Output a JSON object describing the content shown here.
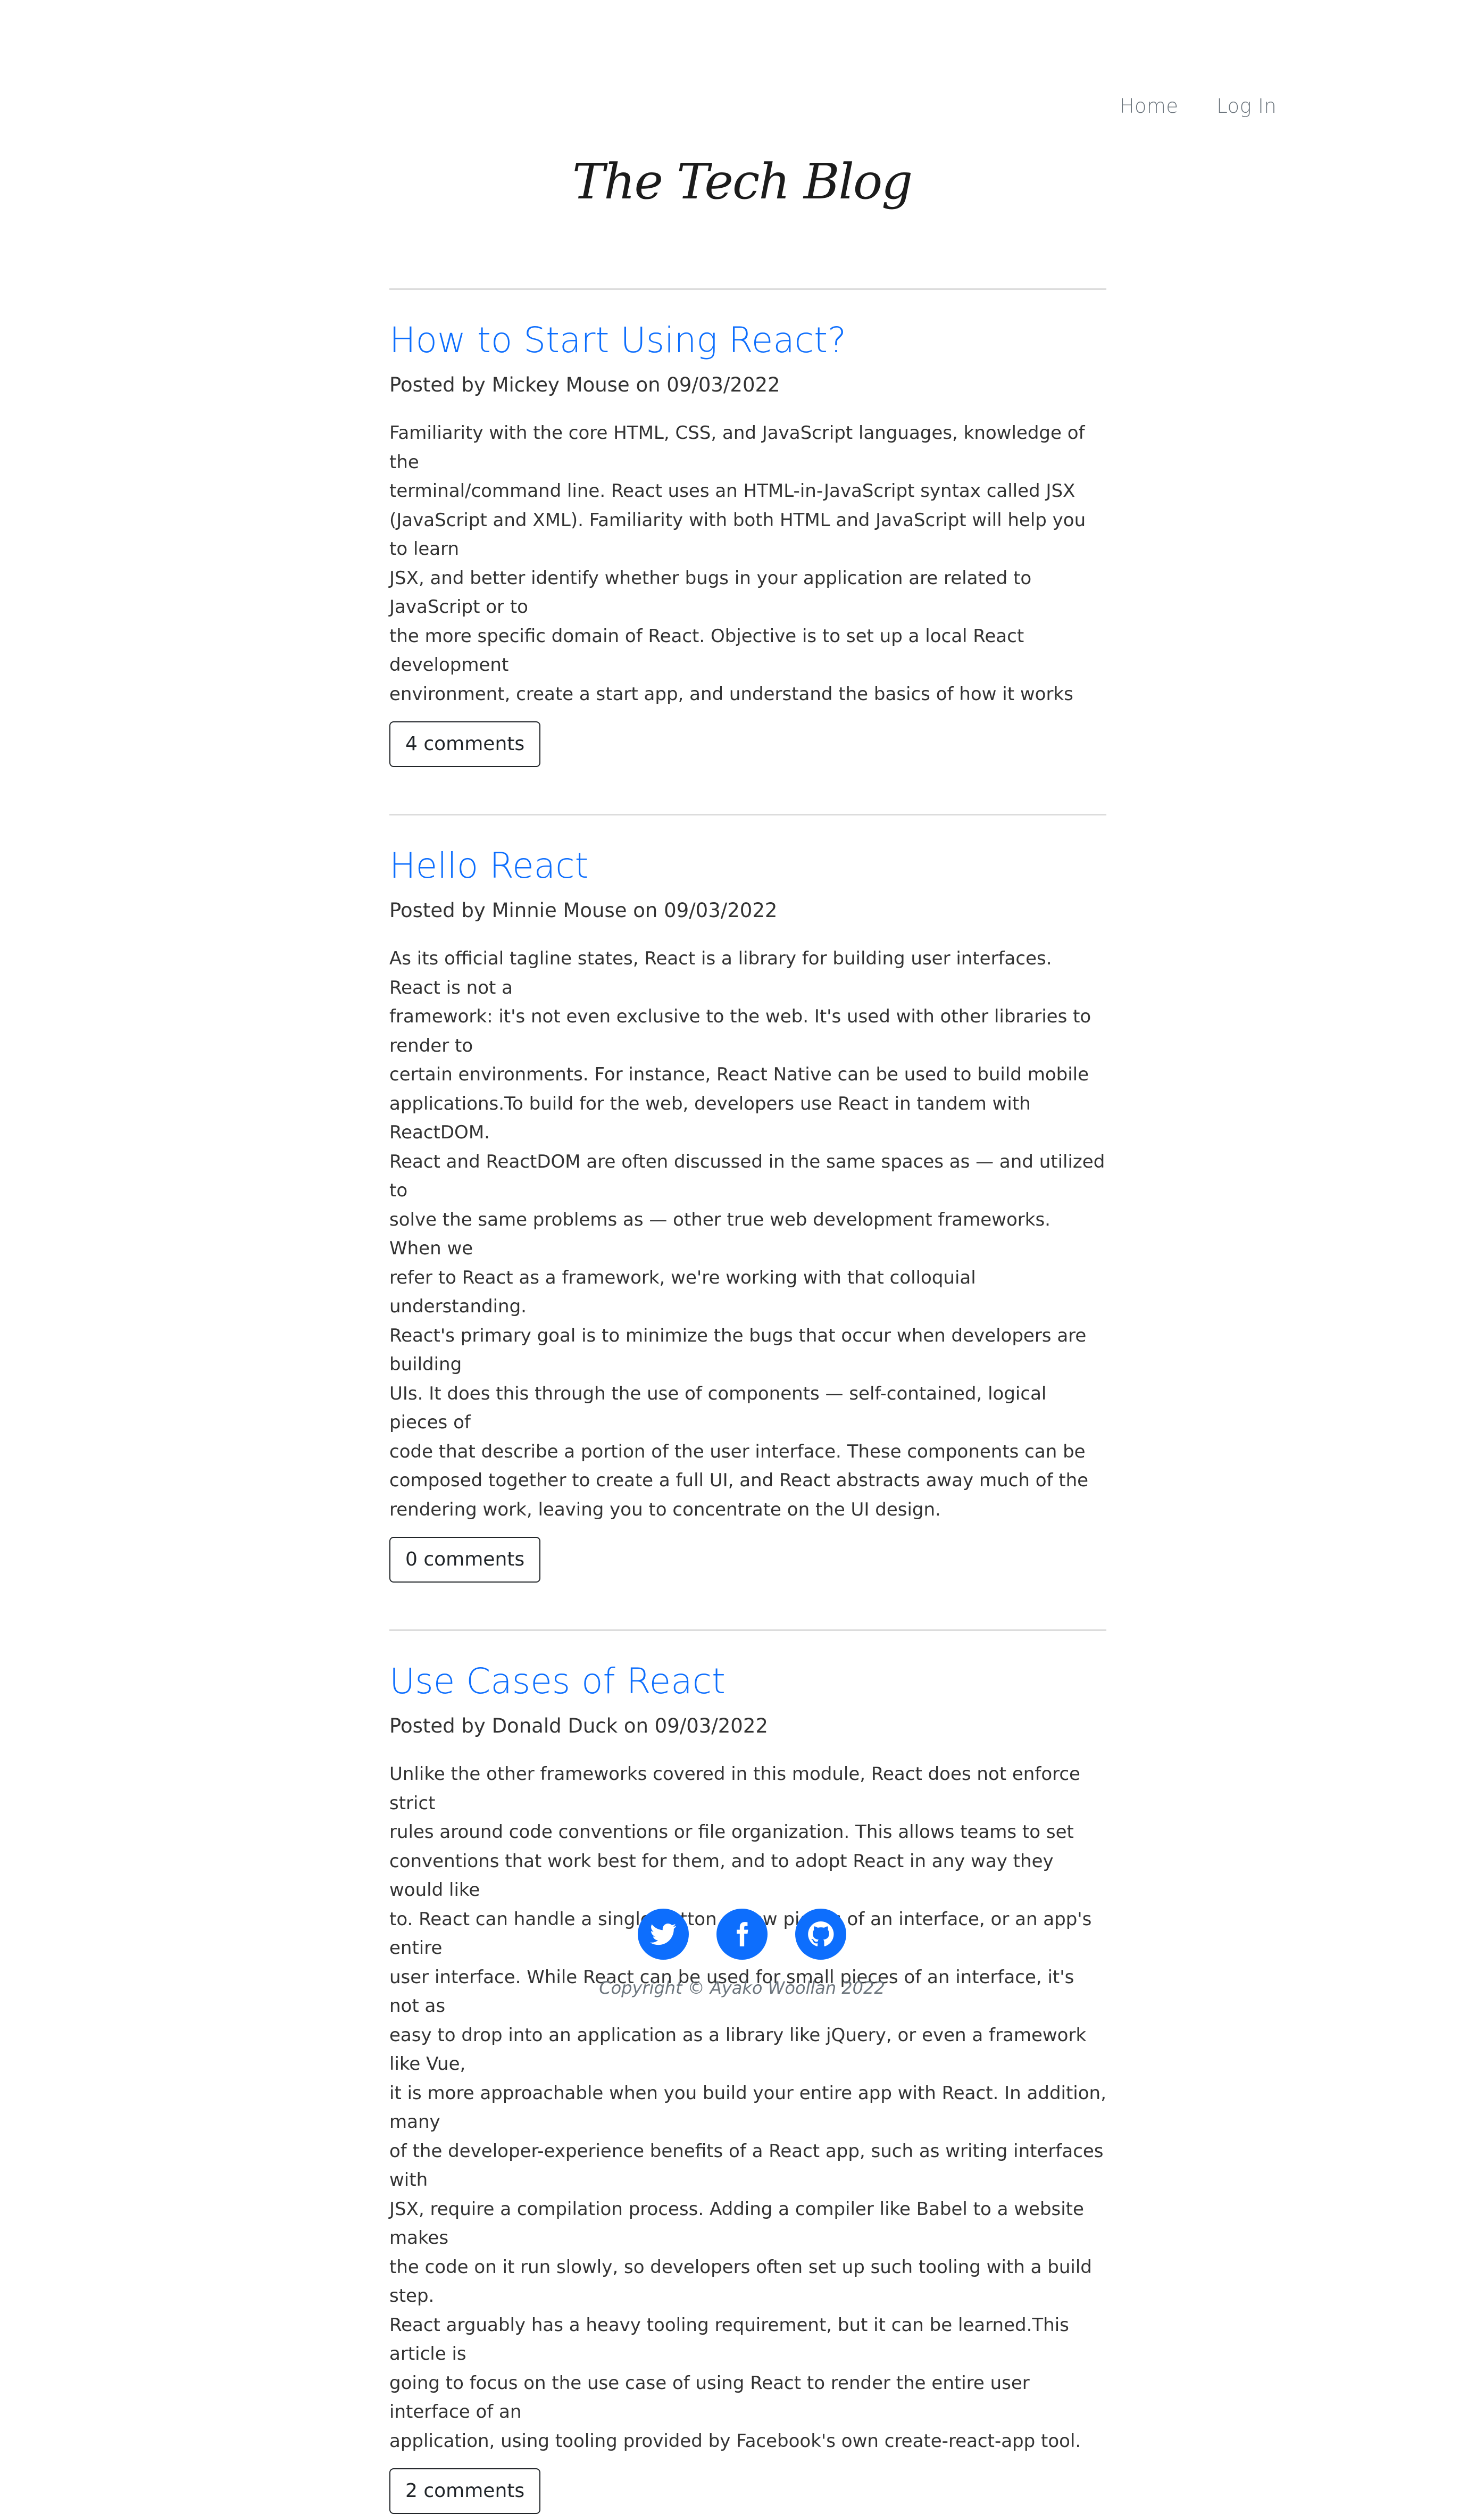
{
  "nav": {
    "items": [
      {
        "label": "Home"
      },
      {
        "label": "Log In"
      }
    ]
  },
  "header": {
    "logo_text": "The Tech Blog"
  },
  "posts": [
    {
      "title": "How to Start Using React?",
      "meta": "Posted by Mickey Mouse on 09/03/2022",
      "body": "Familiarity with the core HTML, CSS, and JavaScript languages, knowledge of the\nterminal/command line. React uses an HTML-in-JavaScript syntax called JSX\n(JavaScript and XML). Familiarity with both HTML and JavaScript will help you to learn\nJSX, and better identify whether bugs in your application are related to JavaScript or to\nthe more specific domain of React. Objective is to set up a local React development\nenvironment, create a start app, and understand the basics of how it works",
      "comments_label": "4 comments"
    },
    {
      "title": "Hello React",
      "meta": "Posted by Minnie Mouse on 09/03/2022",
      "body": "As its official tagline states, React is a library for building user interfaces. React is not a\nframework: it's not even exclusive to the web. It's used with other libraries to render to\ncertain environments. For instance, React Native can be used to build mobile\napplications.To build for the web, developers use React in tandem with ReactDOM.\nReact and ReactDOM are often discussed in the same spaces as — and utilized to\nsolve the same problems as — other true web development frameworks. When we\nrefer to React as a framework, we're working with that colloquial understanding.\nReact's primary goal is to minimize the bugs that occur when developers are building\nUIs. It does this through the use of components — self-contained, logical pieces of\ncode that describe a portion of the user interface. These components can be\ncomposed together to create a full UI, and React abstracts away much of the\nrendering work, leaving you to concentrate on the UI design.",
      "comments_label": "0 comments"
    },
    {
      "title": "Use Cases of React",
      "meta": "Posted by Donald Duck on 09/03/2022",
      "body": "Unlike the other frameworks covered in this module, React does not enforce strict\nrules around code conventions or file organization. This allows teams to set\nconventions that work best for them, and to adopt React in any way they would like\nto. React can handle a single button, a few pieces of an interface, or an app's entire\nuser interface. While React can be used for small pieces of an interface, it's not as\neasy to drop into an application as a library like jQuery, or even a framework like Vue,\nit is more approachable when you build your entire app with React. In addition, many\nof the developer-experience benefits of a React app, such as writing interfaces with\nJSX, require a compilation process. Adding a compiler like Babel to a website makes\nthe code on it run slowly, so developers often set up such tooling with a build step.\nReact arguably has a heavy tooling requirement, but it can be learned.This article is\ngoing to focus on the use case of using React to render the entire user interface of an\napplication, using tooling provided by Facebook's own create-react-app tool.",
      "comments_label": "2 comments"
    }
  ],
  "footer": {
    "socials": [
      {
        "icon": "twitter-icon"
      },
      {
        "icon": "facebook-icon"
      },
      {
        "icon": "github-icon"
      }
    ],
    "copyright": "Copyright © Ayako Woollan 2022"
  },
  "colors": {
    "accent": "#0d6efd",
    "text": "#212529",
    "muted": "#6c757d",
    "divider": "#dcdcdc"
  }
}
